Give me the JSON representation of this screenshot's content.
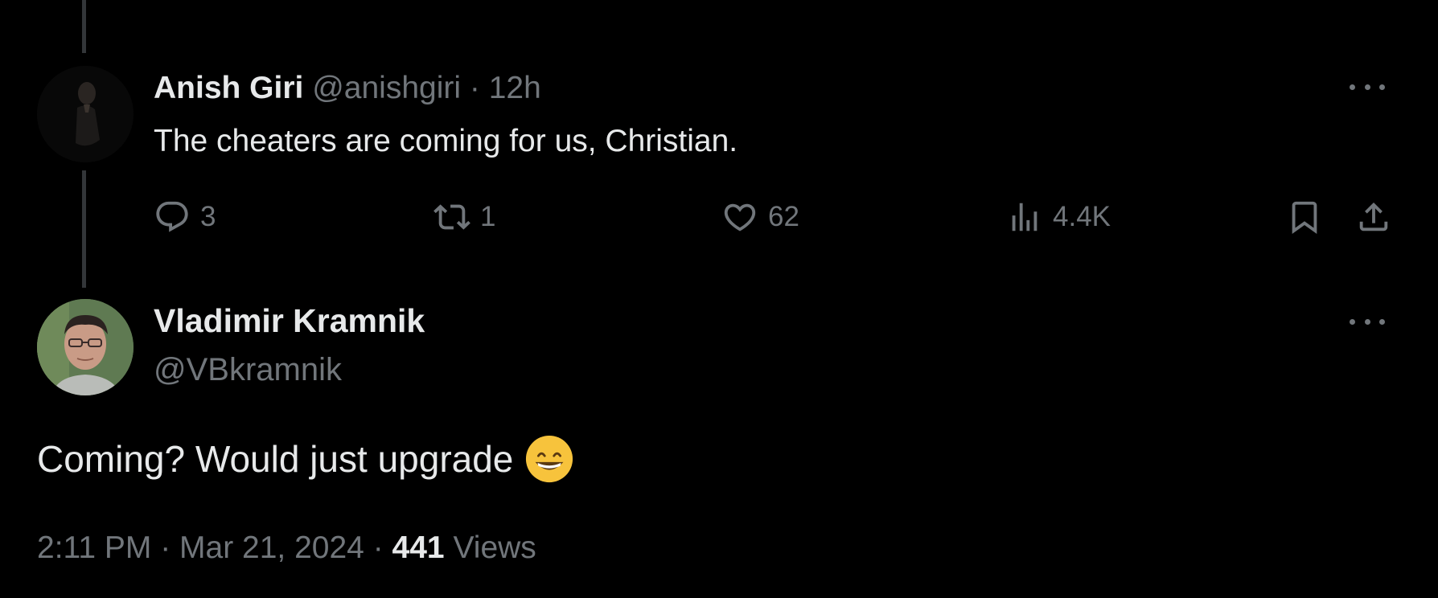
{
  "reply": {
    "display_name": "Anish Giri",
    "handle": "@anishgiri",
    "separator": "·",
    "time": "12h",
    "text": "The cheaters are coming for us, Christian.",
    "actions": {
      "replies": "3",
      "reposts": "1",
      "likes": "62",
      "views": "4.4K"
    }
  },
  "main_post": {
    "display_name": "Vladimir Kramnik",
    "handle": "@VBkramnik",
    "text": "Coming? Would just upgrade",
    "emoji": "grinning-face-with-smiling-eyes",
    "time": "2:11 PM",
    "separator": "·",
    "date": "Mar 21, 2024",
    "views_count": "441",
    "views_label": "Views"
  },
  "colors": {
    "background": "#000000",
    "primary_text": "#e7e9ea",
    "secondary_text": "#71767b",
    "thread_line": "#333639"
  },
  "icons": [
    "reply-icon",
    "retweet-icon",
    "like-icon",
    "views-icon",
    "bookmark-icon",
    "share-icon",
    "more-icon"
  ]
}
